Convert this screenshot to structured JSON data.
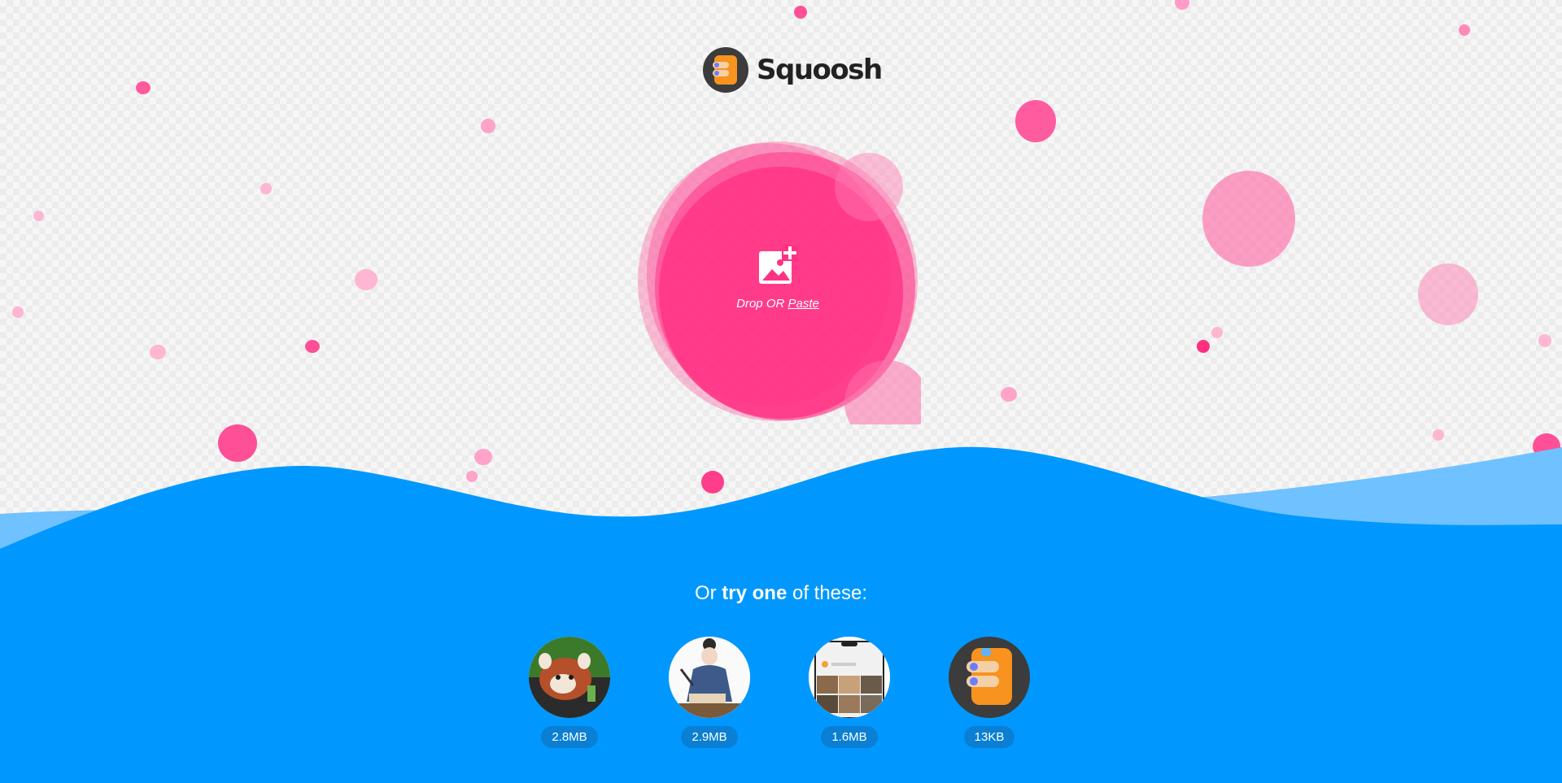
{
  "app": {
    "name": "Squoosh"
  },
  "drop_zone": {
    "prefix": "Drop OR",
    "paste_label": "Paste",
    "icon": "add-image-icon"
  },
  "demos": {
    "title_prefix": "Or",
    "title_bold": "try one",
    "title_suffix": "of these:",
    "items": [
      {
        "size": "2.8MB",
        "icon": "red-panda-photo"
      },
      {
        "size": "2.9MB",
        "icon": "artwork-illustration"
      },
      {
        "size": "1.6MB",
        "icon": "device-screenshot"
      },
      {
        "size": "13KB",
        "icon": "squoosh-logo"
      }
    ]
  },
  "colors": {
    "accent_pink": "#ff3385",
    "accent_blue": "#0098fe",
    "light_blue": "#6fc2ff"
  }
}
